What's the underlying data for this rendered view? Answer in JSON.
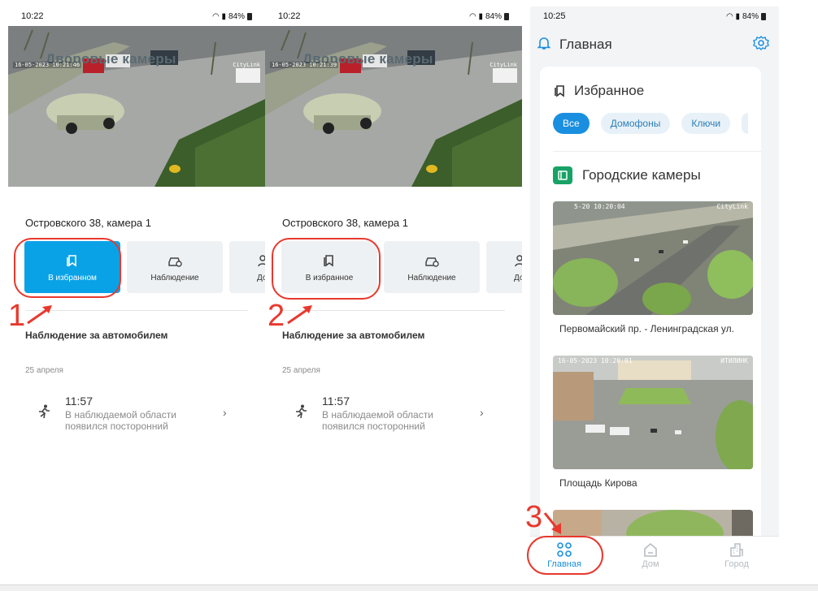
{
  "colors": {
    "accent": "#0aa2e6",
    "annotation": "#e8382e",
    "chip_active": "#1a8fe0",
    "city_green": "#17a366"
  },
  "screens": [
    {
      "status": {
        "time": "10:22",
        "battery": "84%"
      },
      "video": {
        "ghost_title": "Дворовые камеры",
        "timestamp": "16-05-2023 10:21:46",
        "brand": "CityLink"
      },
      "camera_title": "Островского 38, камера 1",
      "actions": [
        {
          "label": "В избранном",
          "icon": "bookmark-icon"
        },
        {
          "label": "Наблюдение",
          "icon": "car-watch-icon"
        },
        {
          "label": "Доступ",
          "icon": "users-icon"
        }
      ],
      "section_title": "Наблюдение за автомобилем",
      "date": "25 апреля",
      "event": {
        "time": "11:57",
        "description": "В наблюдаемой области появился посторонний",
        "icon": "running-person-icon"
      },
      "annotation": "1"
    },
    {
      "status": {
        "time": "10:22",
        "battery": "84%"
      },
      "video": {
        "ghost_title": "Дворовые камеры",
        "timestamp": "16-05-2023 10:21:39",
        "brand": "CityLink"
      },
      "camera_title": "Островского 38, камера 1",
      "actions": [
        {
          "label": "В избранное",
          "icon": "bookmark-icon"
        },
        {
          "label": "Наблюдение",
          "icon": "car-watch-icon"
        },
        {
          "label": "Доступ",
          "icon": "users-icon"
        }
      ],
      "section_title": "Наблюдение за автомобилем",
      "date": "25 апреля",
      "event": {
        "time": "11:57",
        "description": "В наблюдаемой области появился посторонний",
        "icon": "running-person-icon"
      },
      "annotation": "2"
    }
  ],
  "home": {
    "status": {
      "time": "10:25",
      "battery": "84%"
    },
    "title": "Главная",
    "favorites": {
      "title": "Избранное",
      "chips": [
        "Все",
        "Домофоны",
        "Ключи"
      ]
    },
    "city_cameras": {
      "title": "Городские камеры",
      "cameras": [
        {
          "name": "Первомайский пр. - Ленинградская ул.",
          "timestamp": "5-20   10:20:04",
          "brand": "CityLink"
        },
        {
          "name": "Площадь Кирова",
          "timestamp": "16-05-2023 10:20:01",
          "brand": "ИТИЛИНК"
        }
      ]
    },
    "nav": [
      {
        "label": "Главная",
        "icon": "grid-icon"
      },
      {
        "label": "Дом",
        "icon": "home-icon"
      },
      {
        "label": "Город",
        "icon": "city-icon"
      }
    ],
    "annotation": "3"
  }
}
